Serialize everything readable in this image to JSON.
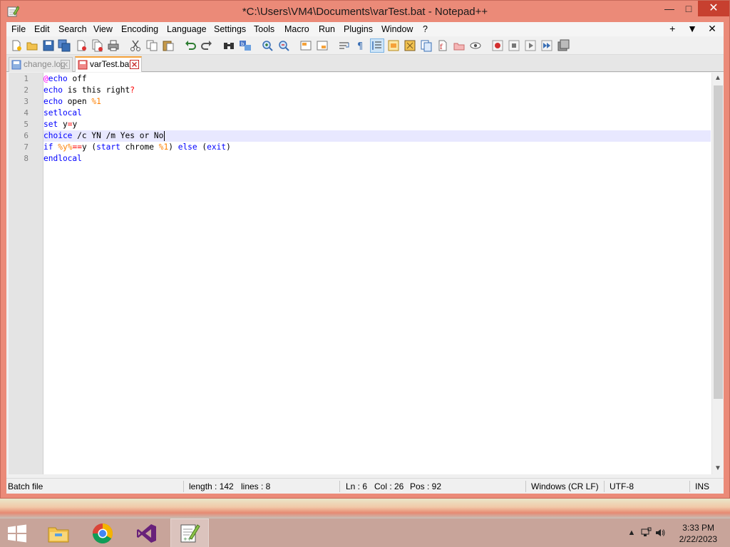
{
  "window": {
    "title": "*C:\\Users\\VM4\\Documents\\varTest.bat - Notepad++",
    "minimize_glyph": "—",
    "maximize_glyph": "□",
    "close_glyph": "✕"
  },
  "menu": {
    "items": [
      "File",
      "Edit",
      "Search",
      "View",
      "Encoding",
      "Language",
      "Settings",
      "Tools",
      "Macro",
      "Run",
      "Plugins",
      "Window",
      "?"
    ],
    "right": [
      "+",
      "▼",
      "✕"
    ]
  },
  "toolbar": {
    "icons": [
      "new-file-icon",
      "open-file-icon",
      "save-icon",
      "save-all-icon",
      "close-icon",
      "close-all-icon",
      "print-icon",
      "cut-icon",
      "copy-icon",
      "paste-icon",
      "undo-icon",
      "redo-icon",
      "find-icon",
      "replace-icon",
      "zoom-in-icon",
      "zoom-out-icon",
      "sync-vertical-icon",
      "sync-horizontal-icon",
      "word-wrap-icon",
      "show-all-characters-icon",
      "indent-guide-icon",
      "user-language-icon",
      "document-map-icon",
      "function-list-icon",
      "folder-workspace-icon",
      "monitoring-icon",
      "record-macro-icon",
      "stop-macro-icon",
      "play-macro-icon",
      "run-macro-multiple-icon",
      "save-macro-icon"
    ]
  },
  "tabs": [
    {
      "label": "change.log",
      "active": false
    },
    {
      "label": "varTest.bat",
      "active": true
    }
  ],
  "editor": {
    "line_numbers": [
      "1",
      "2",
      "3",
      "4",
      "5",
      "6",
      "7",
      "8"
    ],
    "current_line": 6,
    "lines": [
      [
        {
          "t": "@",
          "c": "at"
        },
        {
          "t": "echo",
          "c": "kw"
        },
        {
          "t": " off",
          "c": ""
        }
      ],
      [
        {
          "t": "echo",
          "c": "kw"
        },
        {
          "t": " is this right",
          "c": ""
        },
        {
          "t": "?",
          "c": "op"
        }
      ],
      [
        {
          "t": "echo",
          "c": "kw"
        },
        {
          "t": " open ",
          "c": ""
        },
        {
          "t": "%1",
          "c": "var"
        }
      ],
      [
        {
          "t": "setlocal",
          "c": "kw"
        }
      ],
      [
        {
          "t": "set",
          "c": "kw"
        },
        {
          "t": " y",
          "c": ""
        },
        {
          "t": "=",
          "c": "op"
        },
        {
          "t": "y",
          "c": ""
        }
      ],
      [
        {
          "t": "choice",
          "c": "kw"
        },
        {
          "t": " /c YN /m Yes or No",
          "c": ""
        }
      ],
      [
        {
          "t": "if",
          "c": "kw"
        },
        {
          "t": " ",
          "c": ""
        },
        {
          "t": "%y%",
          "c": "var"
        },
        {
          "t": "==",
          "c": "op"
        },
        {
          "t": "y (",
          "c": ""
        },
        {
          "t": "start",
          "c": "kw"
        },
        {
          "t": " chrome ",
          "c": ""
        },
        {
          "t": "%1",
          "c": "var"
        },
        {
          "t": ") ",
          "c": ""
        },
        {
          "t": "else",
          "c": "kw"
        },
        {
          "t": " (",
          "c": ""
        },
        {
          "t": "exit",
          "c": "kw"
        },
        {
          "t": ")",
          "c": ""
        }
      ],
      [
        {
          "t": "endlocal",
          "c": "kw"
        }
      ]
    ]
  },
  "status": {
    "language": "Batch file",
    "length": "length : 142",
    "lines": "lines : 8",
    "ln": "Ln : 6",
    "col": "Col : 26",
    "pos": "Pos : 92",
    "eol": "Windows (CR LF)",
    "encoding": "UTF-8",
    "mode": "INS"
  },
  "taskbar": {
    "apps": [
      "file-explorer-icon",
      "chrome-icon",
      "visual-studio-icon",
      "notepad-plus-plus-icon"
    ],
    "time": "3:33 PM",
    "date": "2/22/2023"
  },
  "colors": {
    "frame": "#eb8a78",
    "keyword": "#0000ff",
    "operator": "#ff0000",
    "variable": "#ff8000",
    "at_sign": "#ff00ff",
    "current_line": "#e8e8ff",
    "active_tab_accent": "#f5a23a"
  }
}
